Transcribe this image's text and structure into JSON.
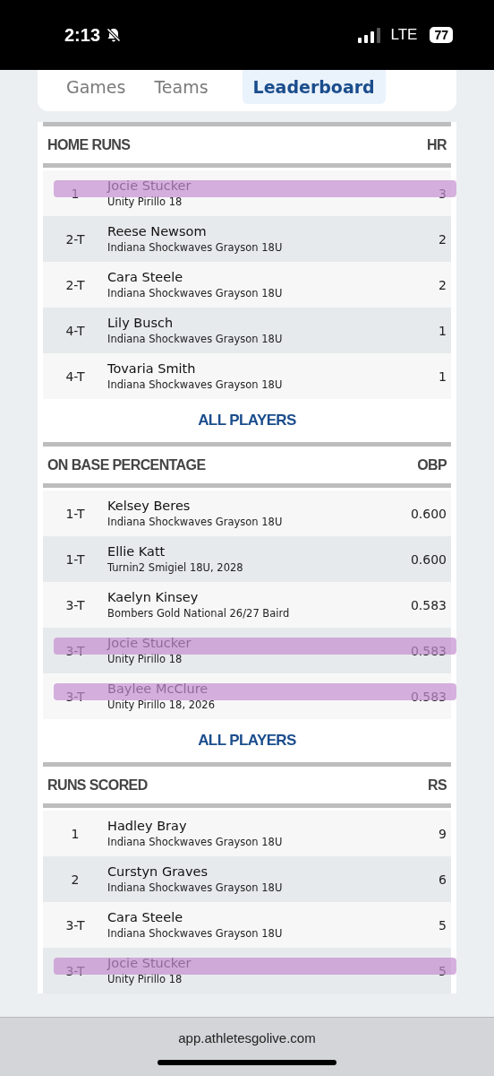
{
  "status_bar": {
    "time": "2:13",
    "network": "LTE",
    "battery": "77"
  },
  "tabs": [
    {
      "label": "Games",
      "selected": false
    },
    {
      "label": "Teams",
      "selected": false
    },
    {
      "label": "Leaderboard",
      "selected": true
    }
  ],
  "sections": [
    {
      "title": "HOME RUNS",
      "stat": "HR",
      "link": "ALL PLAYERS",
      "rows": [
        {
          "rank": "1",
          "name": "Jocie Stucker",
          "team": "Unity Pirillo 18",
          "value": "3",
          "highlighted": true
        },
        {
          "rank": "2-T",
          "name": "Reese Newsom",
          "team": "Indiana Shockwaves Grayson 18U",
          "value": "2",
          "highlighted": false
        },
        {
          "rank": "2-T",
          "name": "Cara Steele",
          "team": "Indiana Shockwaves Grayson 18U",
          "value": "2",
          "highlighted": false
        },
        {
          "rank": "4-T",
          "name": "Lily Busch",
          "team": "Indiana Shockwaves Grayson 18U",
          "value": "1",
          "highlighted": false
        },
        {
          "rank": "4-T",
          "name": "Tovaria Smith",
          "team": "Indiana Shockwaves Grayson 18U",
          "value": "1",
          "highlighted": false
        }
      ]
    },
    {
      "title": "ON BASE PERCENTAGE",
      "stat": "OBP",
      "link": "ALL PLAYERS",
      "rows": [
        {
          "rank": "1-T",
          "name": "Kelsey Beres",
          "team": "Indiana Shockwaves Grayson 18U",
          "value": "0.600",
          "highlighted": false
        },
        {
          "rank": "1-T",
          "name": "Ellie Katt",
          "team": "Turnin2 Smigiel 18U, 2028",
          "value": "0.600",
          "highlighted": false
        },
        {
          "rank": "3-T",
          "name": "Kaelyn Kinsey",
          "team": "Bombers Gold National 26/27 Baird",
          "value": "0.583",
          "highlighted": false
        },
        {
          "rank": "3-T",
          "name": "Jocie Stucker",
          "team": "Unity Pirillo 18",
          "value": "0.583",
          "highlighted": true
        },
        {
          "rank": "3-T",
          "name": "Baylee McClure",
          "team": "Unity Pirillo 18, 2026",
          "value": "0.583",
          "highlighted": true
        }
      ]
    },
    {
      "title": "RUNS SCORED",
      "stat": "RS",
      "rows": [
        {
          "rank": "1",
          "name": "Hadley Bray",
          "team": "Indiana Shockwaves Grayson 18U",
          "value": "9",
          "highlighted": false
        },
        {
          "rank": "2",
          "name": "Curstyn Graves",
          "team": "Indiana Shockwaves Grayson 18U",
          "value": "6",
          "highlighted": false
        },
        {
          "rank": "3-T",
          "name": "Cara Steele",
          "team": "Indiana Shockwaves Grayson 18U",
          "value": "5",
          "highlighted": false
        },
        {
          "rank": "3-T",
          "name": "Jocie Stucker",
          "team": "Unity Pirillo 18",
          "value": "5",
          "highlighted": true
        }
      ]
    }
  ],
  "address_bar": {
    "url": "app.athletesgolive.com"
  }
}
